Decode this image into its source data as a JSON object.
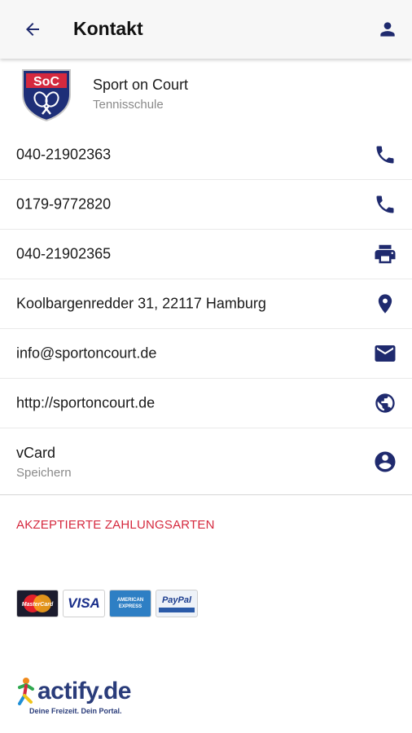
{
  "appbar": {
    "title": "Kontakt"
  },
  "organization": {
    "name": "Sport on Court",
    "subtitle": "Tennisschule",
    "logo_text": "SoC"
  },
  "contacts": [
    {
      "text": "040-21902363",
      "icon": "phone-icon"
    },
    {
      "text": "0179-9772820",
      "icon": "phone-icon"
    },
    {
      "text": "040-21902365",
      "icon": "printer-icon"
    },
    {
      "text": "Koolbargenredder 31, 22117 Hamburg",
      "icon": "location-pin-icon"
    },
    {
      "text": "info@sportoncourt.de",
      "icon": "mail-icon"
    },
    {
      "text": "http://sportoncourt.de",
      "icon": "globe-icon"
    }
  ],
  "vcard": {
    "title": "vCard",
    "subtitle": "Speichern",
    "icon": "account-circle-icon"
  },
  "payments": {
    "title": "AKZEPTIERTE ZAHLUNGSARTEN",
    "methods": [
      "MasterCard",
      "VISA",
      "AMERICAN EXPRESS",
      "PayPal"
    ]
  },
  "footer": {
    "brand": "actify.de",
    "tagline": "Deine Freizeit. Dein Portal."
  },
  "colors": {
    "accent": "#1f2a6e",
    "link_red": "#d5293e",
    "appbar_bg": "#f7f7f7"
  }
}
